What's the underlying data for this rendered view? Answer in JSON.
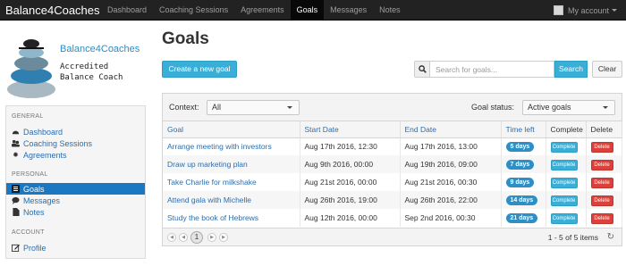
{
  "navbar": {
    "brand": "Balance4Coaches",
    "items": [
      "Dashboard",
      "Coaching Sessions",
      "Agreements",
      "Goals",
      "Messages",
      "Notes"
    ],
    "active": "Goals",
    "account_label": "My account"
  },
  "profile": {
    "name": "Balance4Coaches",
    "title_line1": "Accredited",
    "title_line2": "Balance Coach"
  },
  "sidebar": {
    "sections": [
      {
        "header": "GENERAL",
        "items": [
          {
            "label": "Dashboard",
            "icon": "dashboard-icon"
          },
          {
            "label": "Coaching Sessions",
            "icon": "people-icon"
          },
          {
            "label": "Agreements",
            "icon": "gear-icon"
          }
        ]
      },
      {
        "header": "PERSONAL",
        "items": [
          {
            "label": "Goals",
            "icon": "list-icon",
            "active": true
          },
          {
            "label": "Messages",
            "icon": "chat-icon"
          },
          {
            "label": "Notes",
            "icon": "file-icon"
          }
        ]
      },
      {
        "header": "ACCOUNT",
        "items": [
          {
            "label": "Profile",
            "icon": "edit-icon"
          }
        ]
      }
    ]
  },
  "main": {
    "title": "Goals",
    "create_button": "Create a new goal",
    "search_placeholder": "Search for goals...",
    "search_button": "Search",
    "clear_button": "Clear"
  },
  "grid": {
    "context_label": "Context:",
    "context_value": "All",
    "status_label": "Goal status:",
    "status_value": "Active goals",
    "columns": [
      "Goal",
      "Start Date",
      "End Date",
      "Time left",
      "Complete",
      "Delete"
    ],
    "complete_label": "Complete",
    "delete_label": "Delete",
    "rows": [
      {
        "goal": "Arrange meeting with investors",
        "start": "Aug 17th 2016, 12:30",
        "end": "Aug 17th 2016, 13:00",
        "time_left": "5 days"
      },
      {
        "goal": "Draw up marketing plan",
        "start": "Aug 9th 2016, 00:00",
        "end": "Aug 19th 2016, 09:00",
        "time_left": "7 days"
      },
      {
        "goal": "Take Charlie for milkshake",
        "start": "Aug 21st 2016, 00:00",
        "end": "Aug 21st 2016, 00:30",
        "time_left": "9 days"
      },
      {
        "goal": "Attend gala with Michelle",
        "start": "Aug 26th 2016, 19:00",
        "end": "Aug 26th 2016, 22:00",
        "time_left": "14 days"
      },
      {
        "goal": "Study the book of Hebrews",
        "start": "Aug 12th 2016, 00:00",
        "end": "Sep 2nd 2016, 00:30",
        "time_left": "21 days"
      }
    ],
    "pager": {
      "current_page": "1",
      "info": "1 - 5 of 5 items"
    }
  },
  "colors": {
    "navbar_bg": "#222222",
    "accent": "#39aed6",
    "link": "#2a6eb0",
    "active_sidebar": "#1a78c2",
    "delete": "#d9413a",
    "badge": "#2f8fc4"
  }
}
